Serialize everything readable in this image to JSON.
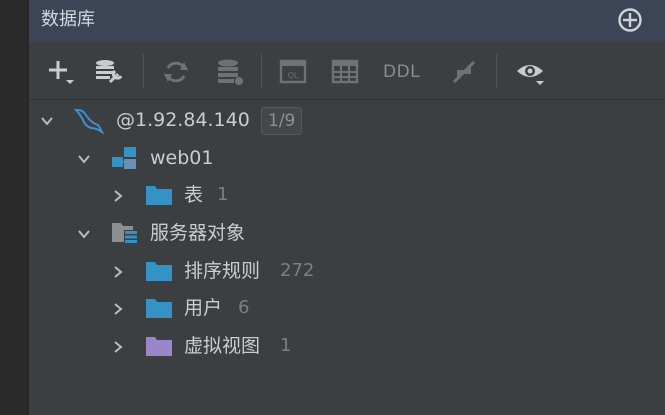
{
  "panel": {
    "title": "数据库",
    "target_icon": "crosshair-add-icon"
  },
  "toolbar": {
    "items": [
      "add-icon",
      "data-source-properties-icon",
      "refresh-icon",
      "schema-sync-icon",
      "query-console-icon",
      "table-icon",
      "ddl",
      "jump-icon",
      "view-options-icon"
    ],
    "ddl_label": "DDL"
  },
  "tree": {
    "root": {
      "label": "@1.92.84.140",
      "badge": "1/9",
      "icon": "mysql-dolphin-icon"
    },
    "schema": {
      "label": "web01",
      "icon": "schema-icon"
    },
    "tables": {
      "label": "表",
      "count": "1",
      "icon": "folder-icon"
    },
    "server_objects": {
      "label": "服务器对象",
      "icon": "server-objects-icon"
    },
    "collations": {
      "label": "排序规则",
      "count": "272",
      "icon": "folder-icon"
    },
    "users": {
      "label": "用户",
      "count": "6",
      "icon": "folder-icon"
    },
    "virtual_views": {
      "label": "虚拟视图",
      "count": "1",
      "icon": "purple-folder-icon"
    }
  },
  "colors": {
    "header_bg": "#3c4556",
    "panel_bg": "#3c3f41",
    "folder_blue": "#3592c4",
    "folder_purple": "#9a86c8",
    "mysql_blue": "#3d8fd0"
  }
}
